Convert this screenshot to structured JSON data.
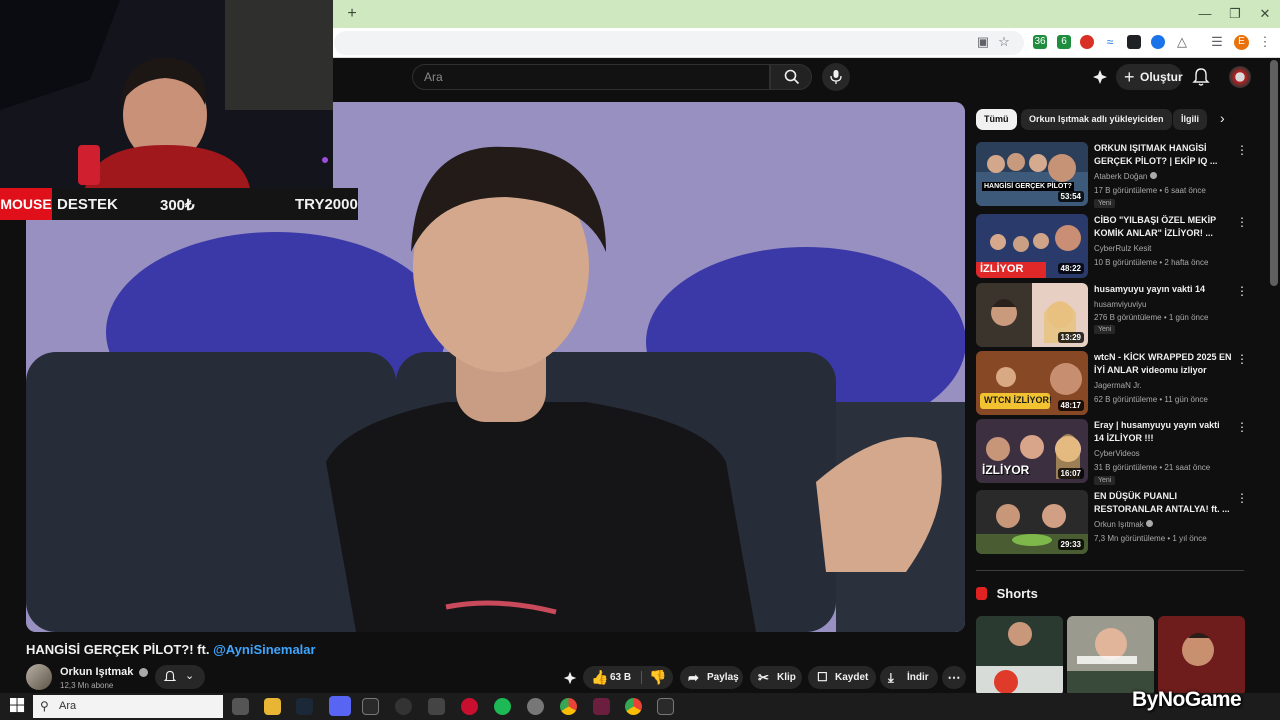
{
  "browser": {
    "new_tab_glyph": "+",
    "extensions": [
      {
        "icon": "cast-icon",
        "color": "#5f6368"
      },
      {
        "icon": "star-icon",
        "color": "#5f6368"
      },
      {
        "icon": "extension-icon",
        "color": "#1e8e3e",
        "badge": "36"
      },
      {
        "icon": "extension-icon",
        "color": "#1e8e3e",
        "badge": "6"
      },
      {
        "icon": "record-icon",
        "color": "#d93025"
      },
      {
        "icon": "wave-icon",
        "color": "#1a73e8"
      },
      {
        "icon": "box-icon",
        "color": "#202124"
      },
      {
        "icon": "vpn-icon",
        "color": "#1a73e8"
      },
      {
        "icon": "puzzle-icon",
        "color": "#5f6368"
      },
      {
        "icon": "media-icon",
        "color": "#5f6368"
      }
    ],
    "profile_initial": "E",
    "profile_color": "#e8710a"
  },
  "youtube": {
    "search_placeholder": "Ara",
    "create_label": "Oluştur"
  },
  "stream_overlay": {
    "mouse_label": "MOUSE",
    "destek_label": "DESTEK",
    "amount": "300₺",
    "goal": "TRY2000"
  },
  "video": {
    "title_prefix": "HANGİSİ GERÇEK PİLOT?! ft.",
    "title_mention": "@AyniSinemalar",
    "channel_name": "Orkun Işıtmak",
    "subscribers": "12,3 Mn abone",
    "likes": "63 B",
    "share_label": "Paylaş",
    "clip_label": "Klip",
    "save_label": "Kaydet",
    "download_label": "İndir"
  },
  "filters": {
    "chips": [
      "Tümü",
      "Orkun Işıtmak adlı yükleyiciden",
      "İlgili"
    ]
  },
  "recommendations": [
    {
      "title": "ORKUN IŞITMAK HANGİSİ GERÇEK PİLOT? | EKİP IQ ...",
      "channel": "Ataberk Doğan",
      "verified": true,
      "meta": "17 B görüntüleme • 6 saat önce",
      "badge": "Yeni",
      "duration": "53:54",
      "thumb_text": "HANGİSİ GERÇEK PİLOT?"
    },
    {
      "title": "CİBO \"YILBAŞI ÖZEL MEKİP KOMİK ANLAR\" İZLİYOR! ...",
      "channel": "CyberRulz Kesit",
      "verified": false,
      "meta": "10 B görüntüleme • 2 hafta önce",
      "badge": "",
      "duration": "48:22",
      "thumb_text": "İZLİYOR"
    },
    {
      "title": "husamyuyu yayın vakti 14",
      "channel": "husamviyuviyu",
      "verified": false,
      "meta": "276 B görüntüleme • 1 gün önce",
      "badge": "Yeni",
      "duration": "13:29",
      "thumb_text": ""
    },
    {
      "title": "wtcN - KİCK WRAPPED 2025 EN İYİ ANLAR videomu izliyor",
      "channel": "JagermaN Jr.",
      "verified": false,
      "meta": "62 B görüntüleme • 11 gün önce",
      "badge": "",
      "duration": "48:17",
      "thumb_text": "WTCN İZLİYOR!"
    },
    {
      "title": "Eray | husamyuyu yayın vakti 14 İZLİYOR !!!",
      "channel": "CyberVideos",
      "verified": false,
      "meta": "31 B görüntüleme • 21 saat önce",
      "badge": "Yeni",
      "duration": "16:07",
      "thumb_text": "İZLİYOR"
    },
    {
      "title": "EN DÜŞÜK PUANLI RESTORANLAR ANTALYA! ft. ...",
      "channel": "Orkun Işıtmak",
      "verified": true,
      "meta": "7,3 Mn görüntüleme • 1 yıl önce",
      "badge": "",
      "duration": "29:33",
      "thumb_text": ""
    }
  ],
  "shorts": {
    "heading": "Shorts"
  },
  "taskbar": {
    "search_placeholder": "Ara"
  },
  "watermark": "ByNoGame"
}
